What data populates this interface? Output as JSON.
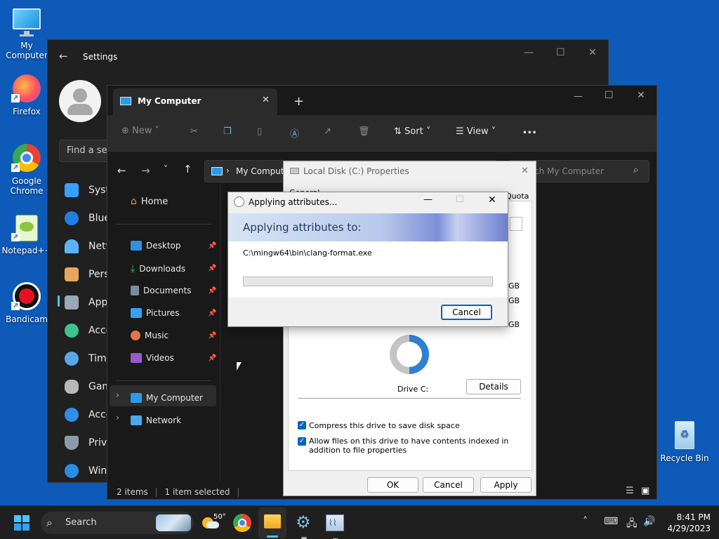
{
  "desktop": {
    "icons": [
      {
        "label": "My Computer"
      },
      {
        "label": "Firefox"
      },
      {
        "label": "Google Chrome"
      },
      {
        "label": "Notepad++"
      },
      {
        "label": "Bandicam"
      },
      {
        "label": "Recycle Bin"
      }
    ]
  },
  "settings": {
    "title": "Settings",
    "find_placeholder": "Find a setting",
    "nav": [
      "System",
      "Bluetooth & devices",
      "Network & internet",
      "Personalization",
      "Apps",
      "Accounts",
      "Time & language",
      "Gaming",
      "Accessibility",
      "Privacy & security",
      "Windows Update"
    ]
  },
  "explorer": {
    "tab_title": "My Computer",
    "toolbar": {
      "new": "New",
      "sort": "Sort",
      "view": "View",
      "more": "..."
    },
    "address": "My Computer",
    "search_placeholder": "Search My Computer",
    "nav": {
      "home": "Home",
      "quick": [
        "Desktop",
        "Downloads",
        "Documents",
        "Pictures",
        "Music",
        "Videos"
      ],
      "my_computer": "My Computer",
      "network": "Network"
    },
    "status": {
      "items": "2 items",
      "selected": "1 item selected"
    }
  },
  "properties": {
    "title": "Local Disk (C:) Properties",
    "tab_general": "General",
    "tab_quota": "Quota",
    "gb": [
      "GB",
      "GB",
      "GB"
    ],
    "drive_label": "Drive C:",
    "details_button": "Details",
    "compress_label": "Compress this drive to save disk space",
    "index_label": "Allow files on this drive to have contents indexed in addition to file properties",
    "ok": "OK",
    "cancel": "Cancel",
    "apply": "Apply"
  },
  "apply_dialog": {
    "title": "Applying attributes...",
    "heading": "Applying attributes to:",
    "path": "C:\\mingw64\\bin\\clang-format.exe",
    "progress": 0,
    "cancel": "Cancel"
  },
  "taskbar": {
    "search_label": "Search",
    "weather": "50°",
    "time": "8:41 PM",
    "date": "4/29/2023"
  },
  "colors": {
    "accent": "#0067c0",
    "desktop": "#0d5ab8",
    "dark": "#202020"
  }
}
